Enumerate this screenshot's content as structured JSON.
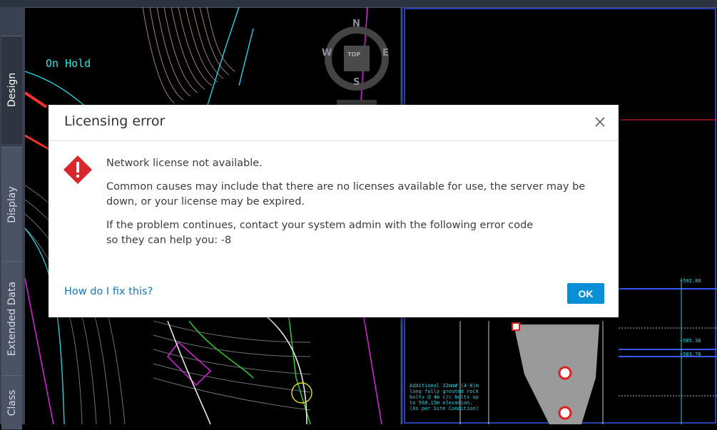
{
  "side_tabs": [
    {
      "label": "Design"
    },
    {
      "label": "Display"
    },
    {
      "label": "Extended Data"
    },
    {
      "label": "Class"
    }
  ],
  "drawing": {
    "on_hold_label": "On Hold",
    "compass": {
      "n": "N",
      "e": "E",
      "s": "S",
      "w": "W",
      "center": "TOP"
    },
    "elevations": [
      "+592.80",
      "+585.38",
      "+583.78"
    ],
    "note": "Additional 32mm# (4-8)m long fully grouted rock bolts @ 4m c/c bolts up to 568.15m elevation. (As per Site Condition)"
  },
  "dialog": {
    "title": "Licensing error",
    "message_line1": "Network license not available.",
    "message_line2": "Common causes may include that there are no licenses available for use, the server may be down, or your license may be expired.",
    "message_line3a": "If the problem continues, contact your system admin with the following error code",
    "message_line3b": "so they can help you: -8",
    "help_link": "How do I fix this?",
    "ok_label": "OK"
  },
  "colors": {
    "accent": "#0a8fd6",
    "error": "#d9262c",
    "link": "#1976b8"
  }
}
